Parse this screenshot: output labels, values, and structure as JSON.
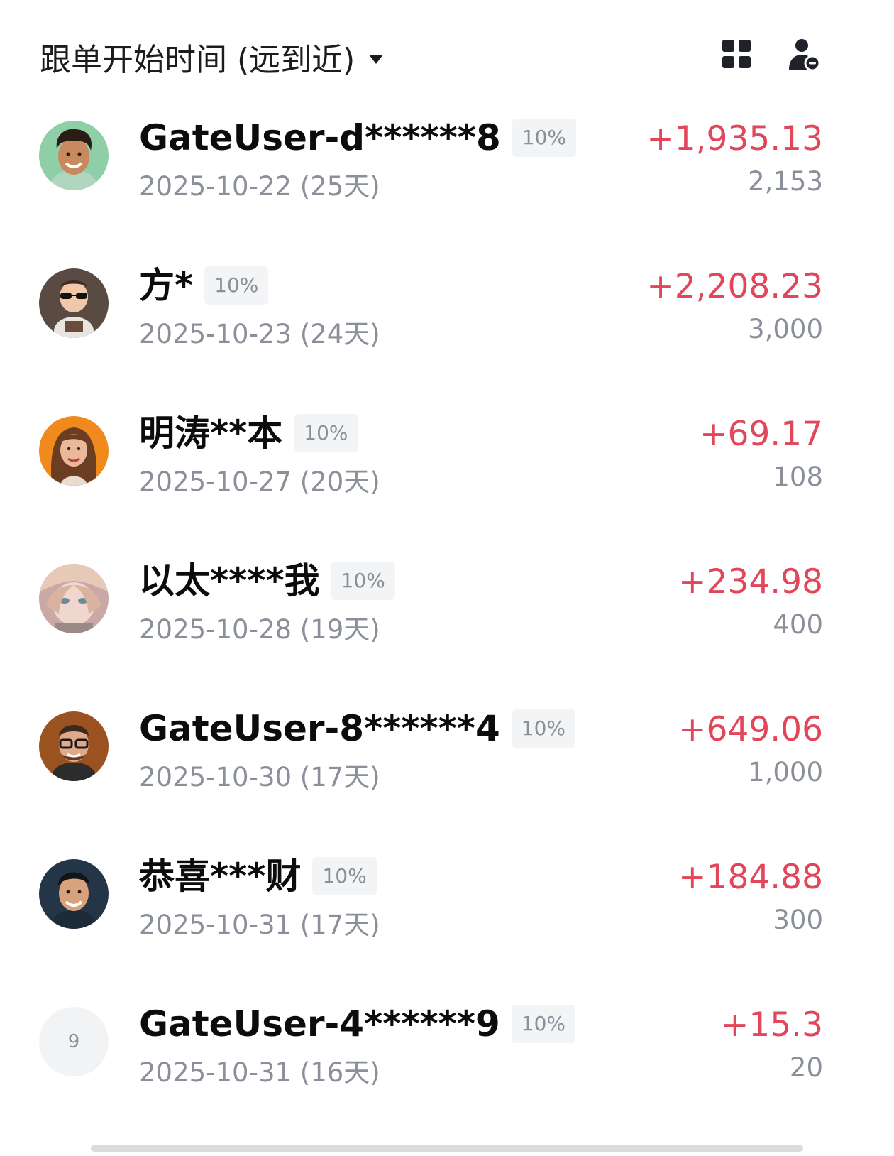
{
  "header": {
    "sort_label": "跟单开始时间 (远到近)",
    "icons": [
      "grid-view-icon",
      "user-remove-icon"
    ]
  },
  "colors": {
    "profit": "#e2465a",
    "muted": "#8a8f99",
    "tag_bg": "#f3f4f6"
  },
  "traders": [
    {
      "name": "GateUser-d******8",
      "tag": "10%",
      "date": "2025-10-22 (25天)",
      "profit": "+1,935.13",
      "amount": "2,153"
    },
    {
      "name": "方*",
      "tag": "10%",
      "date": "2025-10-23 (24天)",
      "profit": "+2,208.23",
      "amount": "3,000"
    },
    {
      "name": "明涛**本",
      "tag": "10%",
      "date": "2025-10-27 (20天)",
      "profit": "+69.17",
      "amount": "108"
    },
    {
      "name": "以太****我",
      "tag": "10%",
      "date": "2025-10-28 (19天)",
      "profit": "+234.98",
      "amount": "400"
    },
    {
      "name": "GateUser-8******4",
      "tag": "10%",
      "date": "2025-10-30 (17天)",
      "profit": "+649.06",
      "amount": "1,000"
    },
    {
      "name": "恭喜***财",
      "tag": "10%",
      "date": "2025-10-31 (17天)",
      "profit": "+184.88",
      "amount": "300"
    },
    {
      "name": "GateUser-4******9",
      "tag": "10%",
      "date": "2025-10-31 (16天)",
      "profit": "+15.3",
      "amount": "20",
      "avatar_text": "9"
    }
  ]
}
